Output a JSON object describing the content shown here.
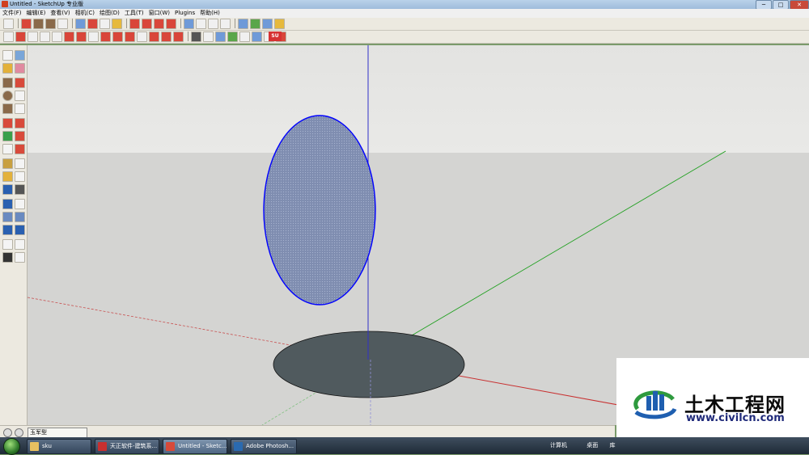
{
  "window": {
    "title": "Untitled - SketchUp 专业版",
    "minimize": "─",
    "maximize": "□",
    "close": "✕"
  },
  "menu": [
    {
      "label": "文件(F)"
    },
    {
      "label": "编辑(E)"
    },
    {
      "label": "查看(V)"
    },
    {
      "label": "相机(C)"
    },
    {
      "label": "绘图(D)"
    },
    {
      "label": "工具(T)"
    },
    {
      "label": "窗口(W)"
    },
    {
      "label": "Plugins"
    },
    {
      "label": "帮助(H)"
    }
  ],
  "toolbar_logo": "SU",
  "statusbar": {
    "field_value": "玉军型"
  },
  "taskbar": {
    "items": [
      {
        "label": "sku",
        "icon": "folder-icon"
      },
      {
        "label": "天正软件-建筑系...",
        "icon": "tangent-icon"
      },
      {
        "label": "Untitled - Sketc...",
        "icon": "sketchup-icon"
      },
      {
        "label": "Adobe Photosh...",
        "icon": "photoshop-icon"
      }
    ],
    "tray": {
      "computer": "计算机",
      "desktop": "桌面",
      "library": "库"
    }
  },
  "watermark": {
    "title": "土木工程网",
    "url": "www.civilcn.com"
  },
  "colors": {
    "shape_face": "#8a98b8",
    "shape_edge": "#0000ff",
    "shadow": "#505a5e",
    "axis_blue": "#3030c8",
    "axis_green": "#20a020",
    "axis_red": "#c83030"
  }
}
